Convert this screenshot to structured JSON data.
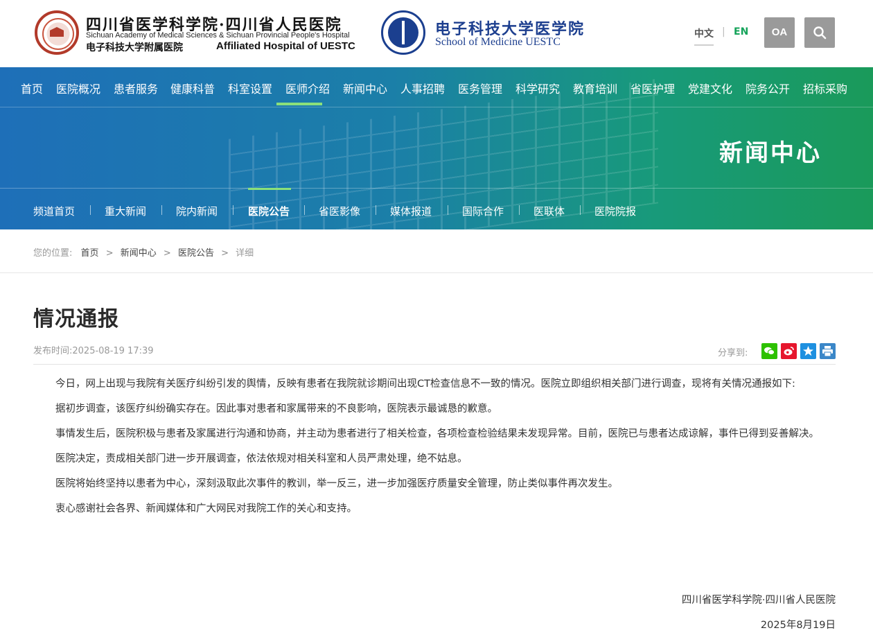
{
  "header": {
    "org_cn": "四川省医学科学院·四川省人民医院",
    "org_en": "Sichuan Academy of Medical Sciences & Sichuan Provincial People's Hospital",
    "affiliated_cn": "电子科技大学附属医院",
    "affiliated_en": "Affiliated Hospital of UESTC",
    "school_cn": "电子科技大学医学院",
    "school_en": "School of Medicine UESTC",
    "lang_zh": "中文",
    "lang_sep": "|",
    "lang_en": "EN",
    "oa_label": "OA",
    "search_icon": "search-icon"
  },
  "main_nav": {
    "items": [
      "首页",
      "医院概况",
      "患者服务",
      "健康科普",
      "科室设置",
      "医师介绍",
      "新闻中心",
      "人事招聘",
      "医务管理",
      "科学研究",
      "教育培训",
      "省医护理",
      "党建文化",
      "院务公开",
      "招标采购"
    ],
    "active": "医师介绍"
  },
  "banner": {
    "title": "新闻中心"
  },
  "sub_nav": {
    "items": [
      "频道首页",
      "重大新闻",
      "院内新闻",
      "医院公告",
      "省医影像",
      "媒体报道",
      "国际合作",
      "医联体",
      "医院院报"
    ],
    "active": "医院公告"
  },
  "breadcrumb": {
    "prefix": "您的位置:",
    "items": [
      "首页",
      "新闻中心",
      "医院公告"
    ],
    "current": "详细"
  },
  "article": {
    "title": "情况通报",
    "published": "发布时间:2025-08-19 17:39",
    "share_label": "分享到:",
    "share_icons": [
      "wechat-icon",
      "weibo-icon",
      "qzone-icon",
      "print-icon"
    ],
    "paragraphs": [
      "今日，网上出现与我院有关医疗纠纷引发的舆情，反映有患者在我院就诊期间出现CT检查信息不一致的情况。医院立即组织相关部门进行调查，现将有关情况通报如下:",
      "据初步调查，该医疗纠纷确实存在。因此事对患者和家属带来的不良影响，医院表示最诚恳的歉意。",
      "事情发生后，医院积极与患者及家属进行沟通和协商，并主动为患者进行了相关检查，各项检查检验结果未发现异常。目前，医院已与患者达成谅解，事件已得到妥善解决。",
      "医院决定，责成相关部门进一步开展调查，依法依规对相关科室和人员严肃处理，绝不姑息。",
      "医院将始终坚持以患者为中心，深刻汲取此次事件的教训，举一反三，进一步加强医疗质量安全管理，防止类似事件再次发生。",
      "衷心感谢社会各界、新闻媒体和广大网民对我院工作的关心和支持。"
    ],
    "signature": "四川省医学科学院·四川省人民医院",
    "date": "2025年8月19日"
  },
  "colors": {
    "nav_blue": "#1e6fb8",
    "nav_green": "#1a9a5a",
    "active_bar": "#8be07a",
    "en_green": "#15a35a",
    "wechat": "#2dc100",
    "weibo": "#e6162d",
    "qzone": "#1e90e0",
    "print": "#3b87c8"
  }
}
